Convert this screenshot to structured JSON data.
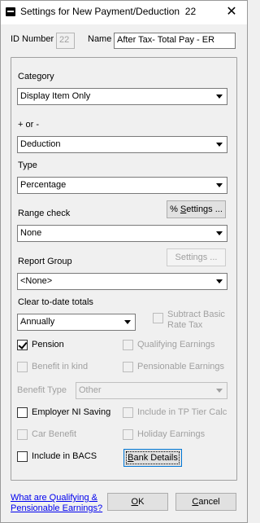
{
  "window": {
    "title": "Settings for New Payment/Deduction",
    "id_suffix": "22",
    "close_glyph": "✕"
  },
  "header": {
    "id_label": "ID Number",
    "id_value": "22",
    "name_label": "Name",
    "name_value": "After Tax- Total Pay - ER"
  },
  "category": {
    "label": "Category",
    "value": "Display Item Only"
  },
  "plus_minus": {
    "label": "+ or -",
    "value": "Deduction"
  },
  "type": {
    "label": "Type",
    "value": "Percentage"
  },
  "settings_button": {
    "prefix": "% ",
    "accel": "S",
    "rest": "ettings ..."
  },
  "range_check": {
    "label": "Range check",
    "value": "None"
  },
  "report_group": {
    "label": "Report Group",
    "value": "<None>",
    "settings_label": "Settings ..."
  },
  "clear_totals": {
    "label": "Clear to-date totals",
    "value": "Annually"
  },
  "subtract_basic_rate_tax": {
    "line1": "Subtract Basic",
    "line2": "Rate Tax",
    "checked": false,
    "enabled": false
  },
  "pension": {
    "label": "Pension",
    "checked": true,
    "enabled": true
  },
  "qualifying_earnings": {
    "label": "Qualifying Earnings",
    "checked": false,
    "enabled": false
  },
  "benefit_in_kind": {
    "label": "Benefit in kind",
    "checked": false,
    "enabled": false
  },
  "pensionable_earnings": {
    "label": "Pensionable Earnings",
    "checked": false,
    "enabled": false
  },
  "benefit_type": {
    "label": "Benefit Type",
    "value": "Other"
  },
  "employer_ni_saving": {
    "label": "Employer NI Saving",
    "checked": false,
    "enabled": true
  },
  "include_tp_tier_calc": {
    "label": "Include in TP Tier Calc",
    "checked": false,
    "enabled": false
  },
  "car_benefit": {
    "label": "Car Benefit",
    "checked": false,
    "enabled": false
  },
  "holiday_earnings": {
    "label": "Holiday Earnings",
    "checked": false,
    "enabled": false
  },
  "include_bacs": {
    "label": "Include in BACS",
    "checked": false,
    "enabled": true
  },
  "bank_details_button": {
    "accel": "B",
    "rest": "ank Details"
  },
  "footer": {
    "link_line1": "What are Qualifying &",
    "link_line2": "Pensionable Earnings?",
    "ok_accel": "O",
    "ok_rest": "K",
    "cancel_pre": "",
    "cancel_accel": "C",
    "cancel_rest": "ancel"
  }
}
